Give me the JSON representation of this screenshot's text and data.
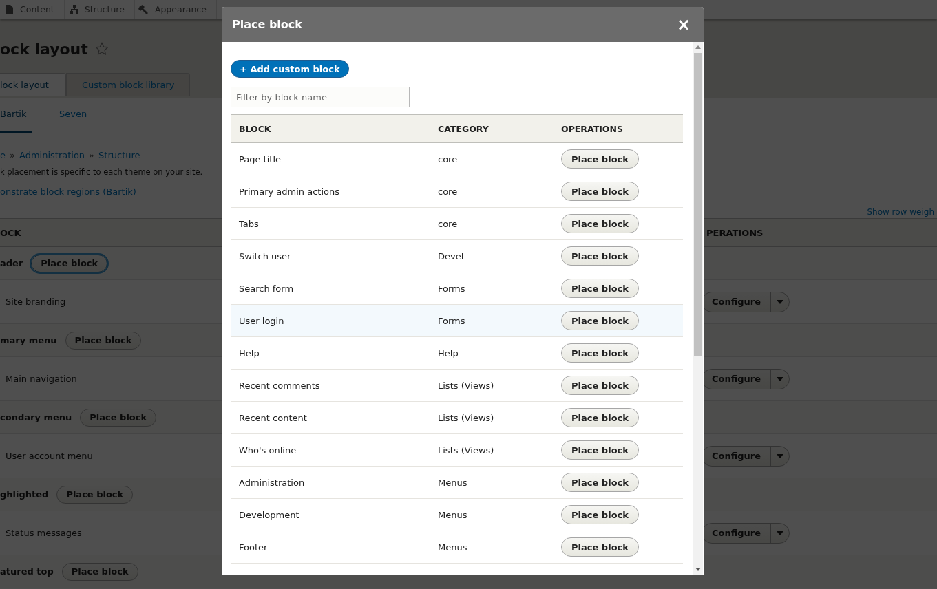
{
  "toolbar": {
    "items": [
      {
        "label": "Content"
      },
      {
        "label": "Structure"
      },
      {
        "label": "Appearance"
      }
    ]
  },
  "page": {
    "title": "ock layout"
  },
  "tabs": [
    {
      "label": "lock layout",
      "selected": true
    },
    {
      "label": "Custom block library",
      "selected": false
    }
  ],
  "theme_tabs": [
    {
      "label": "Bartik",
      "selected": true
    },
    {
      "label": "Seven",
      "selected": false
    }
  ],
  "breadcrumb": {
    "separator": "»",
    "items": [
      "e",
      "Administration",
      "Structure"
    ]
  },
  "description": "k placement is specific to each theme on your site.",
  "demo_link": "onstrate block regions (Bartik)",
  "show_weights": "Show row weigh",
  "table": {
    "columns": [
      "OCK",
      "PERATIONS"
    ],
    "rows": [
      {
        "kind": "region",
        "name": "ader",
        "button": "Place block",
        "focused": true
      },
      {
        "kind": "block",
        "name": "Site branding",
        "button": "Configure"
      },
      {
        "kind": "region",
        "name": "mary menu",
        "button": "Place block",
        "focused": false
      },
      {
        "kind": "block",
        "name": "Main navigation",
        "button": "Configure"
      },
      {
        "kind": "region",
        "name": "condary menu",
        "button": "Place block",
        "focused": false
      },
      {
        "kind": "block",
        "name": "User account menu",
        "button": "Configure"
      },
      {
        "kind": "region",
        "name": "ghlighted",
        "button": "Place block",
        "focused": false
      },
      {
        "kind": "block",
        "name": "Status messages",
        "button": "Configure"
      },
      {
        "kind": "region",
        "name": "atured top",
        "button": "Place block",
        "focused": false
      }
    ]
  },
  "dialog": {
    "title": "Place block",
    "close": "×",
    "add_button": "+ Add custom block",
    "filter": {
      "placeholder": "Filter by block name"
    },
    "columns": [
      "BLOCK",
      "CATEGORY",
      "OPERATIONS"
    ],
    "rows": [
      {
        "block": "Page title",
        "category": "core",
        "button": "Place block",
        "highlighted": false
      },
      {
        "block": "Primary admin actions",
        "category": "core",
        "button": "Place block",
        "highlighted": false
      },
      {
        "block": "Tabs",
        "category": "core",
        "button": "Place block",
        "highlighted": false
      },
      {
        "block": "Switch user",
        "category": "Devel",
        "button": "Place block",
        "highlighted": false
      },
      {
        "block": "Search form",
        "category": "Forms",
        "button": "Place block",
        "highlighted": false
      },
      {
        "block": "User login",
        "category": "Forms",
        "button": "Place block",
        "highlighted": true
      },
      {
        "block": "Help",
        "category": "Help",
        "button": "Place block",
        "highlighted": false
      },
      {
        "block": "Recent comments",
        "category": "Lists (Views)",
        "button": "Place block",
        "highlighted": false
      },
      {
        "block": "Recent content",
        "category": "Lists (Views)",
        "button": "Place block",
        "highlighted": false
      },
      {
        "block": "Who's online",
        "category": "Lists (Views)",
        "button": "Place block",
        "highlighted": false
      },
      {
        "block": "Administration",
        "category": "Menus",
        "button": "Place block",
        "highlighted": false
      },
      {
        "block": "Development",
        "category": "Menus",
        "button": "Place block",
        "highlighted": false
      },
      {
        "block": "Footer",
        "category": "Menus",
        "button": "Place block",
        "highlighted": false
      }
    ]
  }
}
